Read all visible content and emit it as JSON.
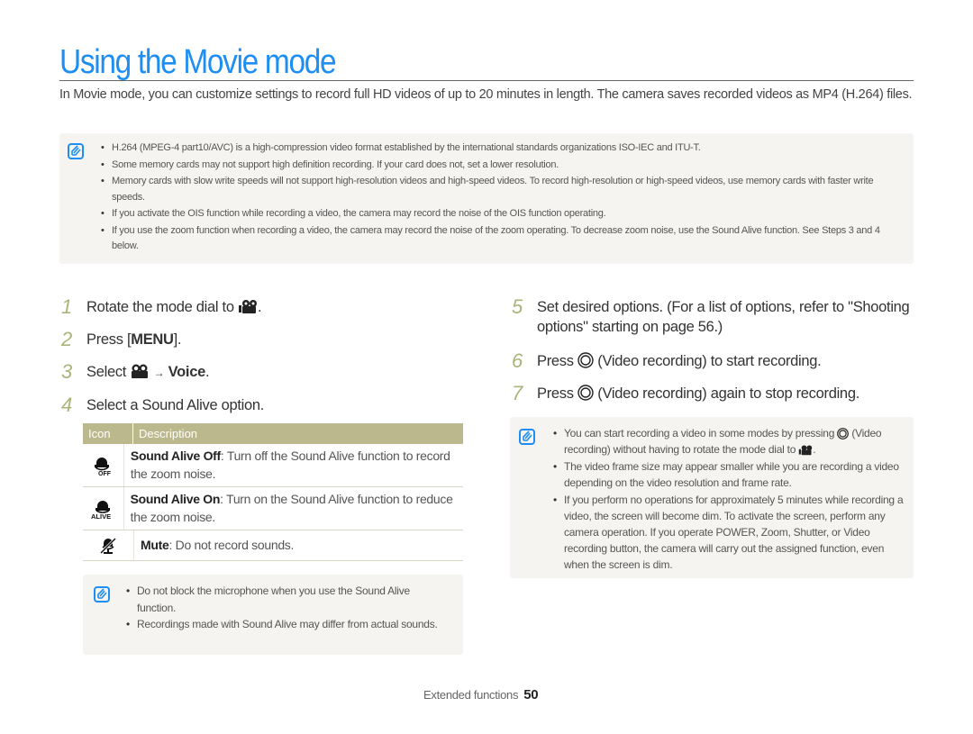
{
  "page": {
    "title": "Using the Movie mode",
    "intro": "In Movie mode, you can customize settings to record full HD videos of up to 20 minutes in length. The camera saves recorded videos as MP4 (H.264) files."
  },
  "top_note": {
    "icon": "note-icon",
    "items": [
      "H.264 (MPEG-4 part10/AVC) is a high-compression video format established by the international standards organizations ISO-IEC and ITU-T.",
      "Some memory cards may not support high definition recording. If your card does not, set a lower resolution.",
      "Memory cards with slow write speeds will not support high-resolution videos and high-speed videos. To record high-resolution or high-speed videos, use memory cards with faster write speeds.",
      "If you activate the OIS function while recording a video, the camera may record the noise of the OIS function operating.",
      "If you use the zoom function when recording a video, the camera may record the noise of the zoom operating. To decrease zoom noise, use the Sound Alive function. See Steps 3 and 4 below."
    ]
  },
  "steps_left": [
    {
      "num": "1",
      "text_before": "Rotate the mode dial to",
      "icon": "movie-mode-icon",
      "text_after": "."
    },
    {
      "num": "2",
      "text_before": "Press [",
      "bold": "MENU",
      "text_after": "]."
    },
    {
      "num": "3",
      "text_before": "Select",
      "icon": "movie-menu-icon",
      "arrow": "→",
      "bold": "Voice",
      "text_after": "."
    },
    {
      "num": "4",
      "text": "Select a Sound Alive option."
    }
  ],
  "table": {
    "headers": [
      "Icon",
      "Description"
    ],
    "rows": [
      {
        "icon": "sound-alive-off-icon",
        "icon_label": "OFF",
        "bold": "Sound Alive Off",
        "text": ": Turn off the Sound Alive function to record the zoom noise."
      },
      {
        "icon": "sound-alive-on-icon",
        "icon_label": "ALIVE",
        "bold": "Sound Alive On",
        "text": ": Turn on the Sound Alive function to reduce the zoom noise."
      },
      {
        "icon": "mute-icon",
        "bold": "Mute",
        "text": ": Do not record sounds."
      }
    ]
  },
  "left_note": {
    "items": [
      "Do not block the microphone when you use the Sound Alive function.",
      "Recordings made with Sound Alive may differ from actual sounds."
    ]
  },
  "steps_right": [
    {
      "num": "5",
      "text": "Set desired options. (For a list of options, refer to \"Shooting options\" starting on page 56.)"
    },
    {
      "num": "6",
      "text_before": "Press",
      "icon": "video-record-button-icon",
      "text_after": "(Video recording) to start recording."
    },
    {
      "num": "7",
      "text_before": "Press",
      "icon": "video-record-button-icon",
      "text_after": "(Video recording) again to stop recording."
    }
  ],
  "right_note": {
    "item1_before": "You can start recording a video in some modes by pressing",
    "item1_middle": "(Video recording) without having to rotate the mode dial to",
    "item1_after": ".",
    "items": [
      "The video frame size may appear smaller while you are recording a video depending on the video resolution and frame rate.",
      "If you perform no operations for approximately 5 minutes while recording a video, the screen will become dim. To activate the screen, perform any camera operation. If you operate POWER, Zoom, Shutter, or Video recording button, the camera will carry out the assigned function, even when the screen is dim."
    ]
  },
  "footer": {
    "section": "Extended functions",
    "page_number": "50"
  },
  "colors": {
    "title": "#1e8ef3",
    "step_number": "#a8b47a",
    "table_header": "#bcb88e",
    "note_bg": "#f5f4f0"
  }
}
